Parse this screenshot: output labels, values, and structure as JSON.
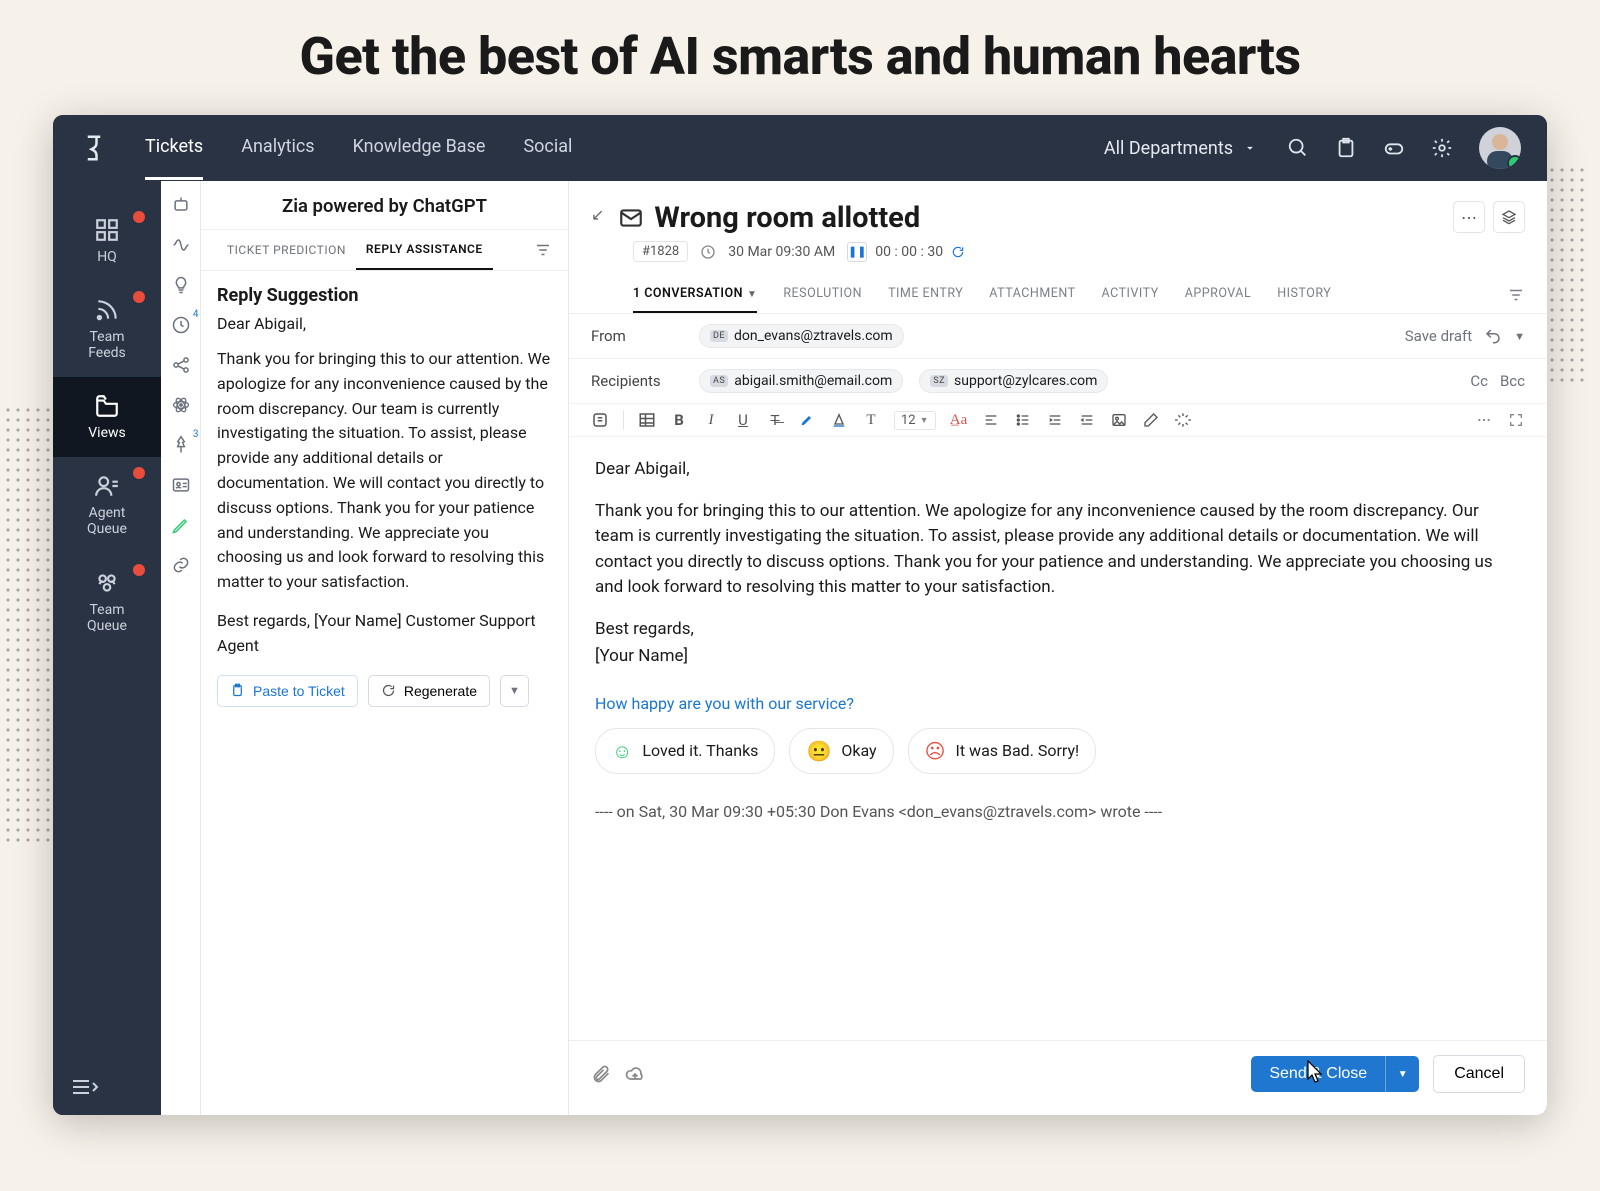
{
  "hero": "Get the best of AI smarts and human hearts",
  "header": {
    "nav": [
      "Tickets",
      "Analytics",
      "Knowledge Base",
      "Social"
    ],
    "department": "All Departments"
  },
  "rail": {
    "hq": "HQ",
    "feeds": "Team\nFeeds",
    "views": "Views",
    "agent": "Agent\nQueue",
    "team": "Team\nQueue"
  },
  "zia": {
    "title": "Zia powered by ChatGPT",
    "tabs": {
      "predict": "TICKET PREDICTION",
      "reply": "REPLY ASSISTANCE"
    },
    "heading": "Reply Suggestion",
    "greeting": "Dear Abigail,",
    "body": "Thank you for bringing this to our attention. We apologize for any inconvenience caused by the room discrepancy. Our team is currently investigating the situation. To assist, please provide any additional details or documentation. We will contact you directly to discuss options. Thank you for your patience and understanding. We appreciate you choosing us and look forward to resolving this matter to your satisfaction.",
    "signoff": "Best regards, [Your Name] Customer Support Agent",
    "paste": "Paste to Ticket",
    "regen": "Regenerate",
    "strip_badges": {
      "lightbulb": "",
      "clock": "4",
      "share": "",
      "atom": "",
      "pin": "3"
    }
  },
  "ticket": {
    "title": "Wrong room allotted",
    "id": "#1828",
    "date": "30 Mar 09:30 AM",
    "timer": "00 : 00 : 30",
    "tabs": {
      "conv": "1 CONVERSATION",
      "res": "RESOLUTION",
      "time": "TIME ENTRY",
      "attach": "ATTACHMENT",
      "activity": "ACTIVITY",
      "approval": "APPROVAL",
      "history": "HISTORY"
    },
    "from_label": "From",
    "from": {
      "badge": "DE",
      "email": "don_evans@ztravels.com"
    },
    "recip_label": "Recipients",
    "recipients": [
      {
        "badge": "AS",
        "email": "abigail.smith@email.com"
      },
      {
        "badge": "SZ",
        "email": "support@zylcares.com"
      }
    ],
    "save_draft": "Save draft",
    "cc": "Cc",
    "bcc": "Bcc",
    "toolbar": {
      "font_size": "12"
    },
    "editor": {
      "greeting": "Dear Abigail,",
      "body": "Thank you for bringing this to our attention. We apologize for any inconvenience caused by the room discrepancy. Our team is currently investigating the situation. To assist, please provide any additional details or documentation. We will contact you directly to discuss options. Thank you for your patience and understanding. We appreciate you choosing us and look forward to resolving this matter to your satisfaction.",
      "regards": "Best regards,",
      "signature": "[Your Name]",
      "survey_q": "How happy are you with our service?",
      "survey_opts": {
        "good": "Loved it. Thanks",
        "ok": "Okay",
        "bad": "It was Bad. Sorry!"
      },
      "quote": "---- on Sat, 30 Mar 09:30 +05:30 Don Evans <don_evans@ztravels.com> wrote ----"
    },
    "footer": {
      "send": "Send & Close",
      "cancel": "Cancel"
    }
  }
}
